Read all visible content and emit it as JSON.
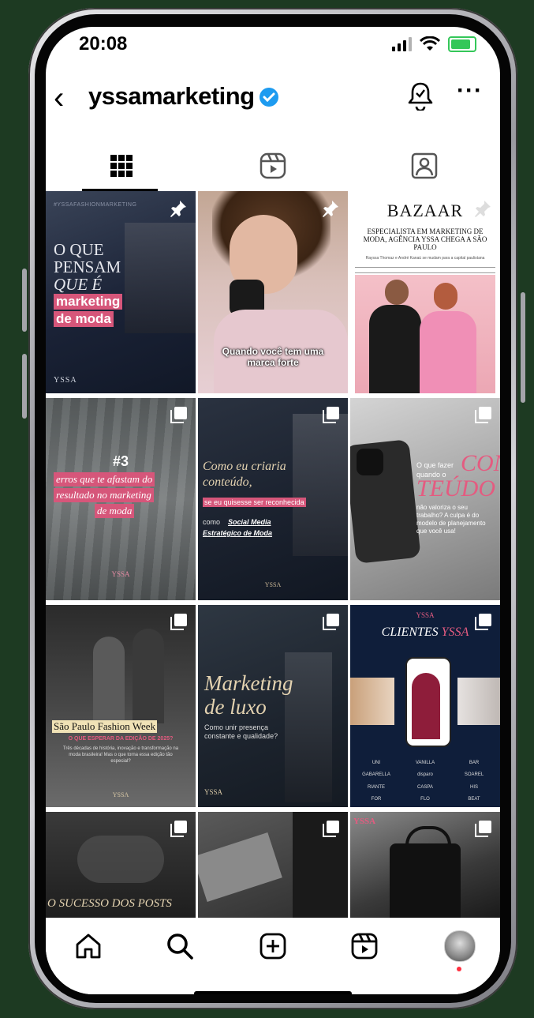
{
  "status": {
    "time": "20:08"
  },
  "profile": {
    "username": "yssamarketing"
  },
  "tabs": [
    {
      "name": "grid",
      "icon": "grid-icon",
      "active": true
    },
    {
      "name": "reels",
      "icon": "reels-icon",
      "active": false
    },
    {
      "name": "tagged",
      "icon": "tagged-icon",
      "active": false
    }
  ],
  "posts": {
    "p1": {
      "pinned": true,
      "top": "#YSSAFASHIONMARKETING",
      "l1": "O QUE",
      "l2": "PENSAM",
      "l3": "QUE É",
      "h1": "marketing",
      "h2": "de moda",
      "brand": "YSSA"
    },
    "p2": {
      "pinned": true,
      "caption": "Quando você tem uma marca forte"
    },
    "p3": {
      "pinned": true,
      "brand": "BAZAAR",
      "headline": "ESPECIALISTA EM MARKETING DE MODA, AGÊNCIA YSSA CHEGA A SÃO PAULO",
      "sub": "Rayssa Thomaz e André Kanaú se mudam para a capital paulistana"
    },
    "p4": {
      "num": "#3",
      "h1": "erros que te afastam do",
      "h2": "resultado no marketing",
      "h3": "de moda",
      "brand": "YSSA"
    },
    "p5": {
      "t1": "Como eu criaria",
      "t2": "conteúdo,",
      "h1": "se eu quisesse ser reconhecida",
      "t3": "como",
      "t4": "Social Media",
      "t5": "Estratégico de Moda",
      "brand": "YSSA"
    },
    "p6": {
      "q1": "O que fazer",
      "q2": "quando o",
      "big1": "CON",
      "big2": "TEÚDO",
      "body": "não valoriza o seu trabalho? A culpa é do modelo de planejamento que você usa!"
    },
    "p7": {
      "hl": "São Paulo Fashion Week",
      "sub": "O QUE ESPERAR DA EDIÇÃO DE 2025?",
      "body": "Três décadas de história, inovação e transformação na moda brasileira! Mas o que torna essa edição tão especial?",
      "brand": "YSSA"
    },
    "p8": {
      "t1": "Marketing",
      "t2": "de luxo",
      "sub": "Como unir presença constante e qualidade?",
      "brand": "YSSA"
    },
    "p9": {
      "brand": "YSSA",
      "t1": "CLIENTES",
      "t2": "YSSA",
      "logos": [
        "UNI",
        "VANILLA",
        "BAR",
        "GABARELLA",
        "disparo",
        "SOAREL",
        "RIANTE",
        "CASPA",
        "HIS",
        "FOR",
        "FLO",
        "BEAT"
      ]
    },
    "p10": {
      "t1": "O SUCESSO DOS POSTS"
    },
    "p12": {
      "brand": "YSSA"
    }
  },
  "nav": [
    {
      "name": "home",
      "icon": "home-icon"
    },
    {
      "name": "search",
      "icon": "search-icon"
    },
    {
      "name": "create",
      "icon": "plus-square-icon"
    },
    {
      "name": "reels",
      "icon": "reels-icon"
    },
    {
      "name": "profile",
      "icon": "avatar"
    }
  ]
}
